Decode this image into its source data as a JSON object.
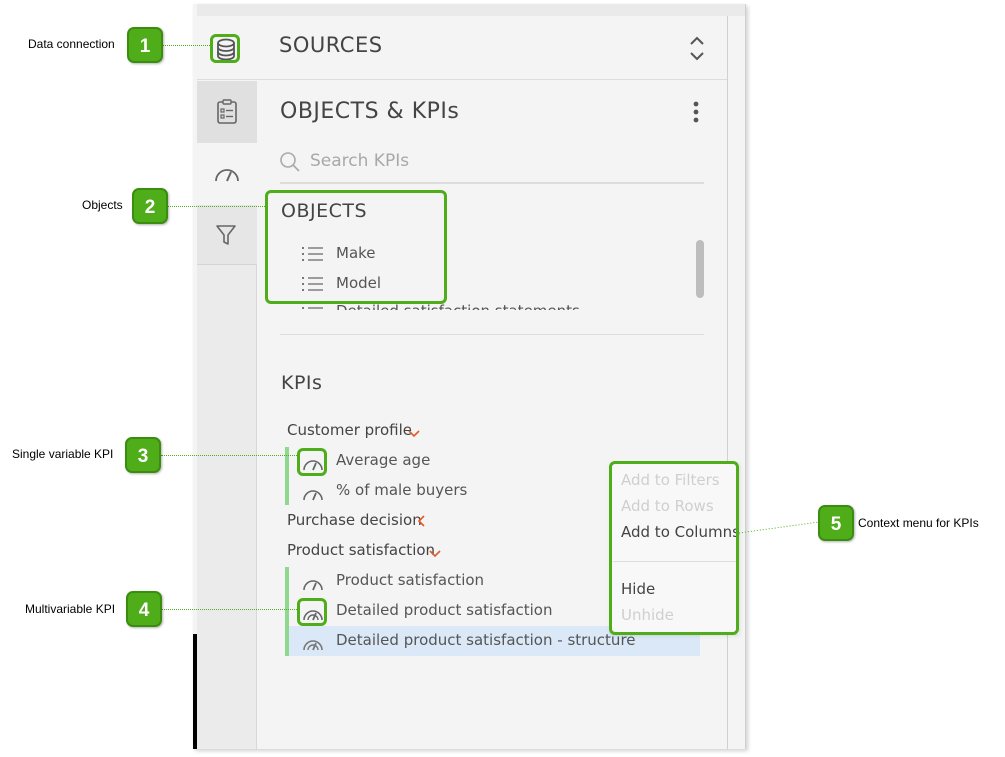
{
  "sources": {
    "title": "SOURCES"
  },
  "panel": {
    "title": "OBJECTS & KPIs",
    "search_placeholder": "Search KPIs"
  },
  "objects": {
    "heading": "OBJECTS",
    "items": [
      "Make",
      "Model",
      "Detailed satisfaction statements"
    ]
  },
  "kpis": {
    "heading": "KPIs",
    "groups": [
      {
        "label": "Customer profile",
        "items": [
          "Average age",
          "% of male buyers"
        ]
      },
      {
        "label": "Purchase decision"
      },
      {
        "label": "Product satisfaction",
        "items": [
          "Product satisfaction",
          "Detailed product satisfaction",
          "Detailed product satisfaction - structure"
        ]
      }
    ]
  },
  "context_menu": {
    "items": [
      {
        "label": "Add to Filters",
        "enabled": false
      },
      {
        "label": "Add to Rows",
        "enabled": false
      },
      {
        "label": "Add to Columns",
        "enabled": true
      },
      {
        "label": "Hide",
        "enabled": true
      },
      {
        "label": "Unhide",
        "enabled": false
      }
    ]
  },
  "callouts": [
    {
      "number": "1",
      "label": "Data connection"
    },
    {
      "number": "2",
      "label": "Objects"
    },
    {
      "number": "3",
      "label": "Single variable KPI"
    },
    {
      "number": "4",
      "label": "Multivariable KPI"
    },
    {
      "number": "5",
      "label": "Context menu for KPIs"
    }
  ],
  "colors": {
    "callout_green": "#4fad19",
    "accent_orange": "#e05a2b",
    "kpi_bar": "#8fd88f",
    "selection": "#dbe8f8"
  },
  "icons": {
    "data_connection": "database-icon",
    "objects_tab": "clipboard-list-icon",
    "kpi_tab": "gauge-icon",
    "filter_tab": "filter-icon",
    "more": "vertical-ellipsis-icon",
    "search": "search-icon",
    "object_item": "list-icon",
    "kpi_item": "gauge-icon",
    "kpi_multi": "multi-gauge-icon"
  }
}
